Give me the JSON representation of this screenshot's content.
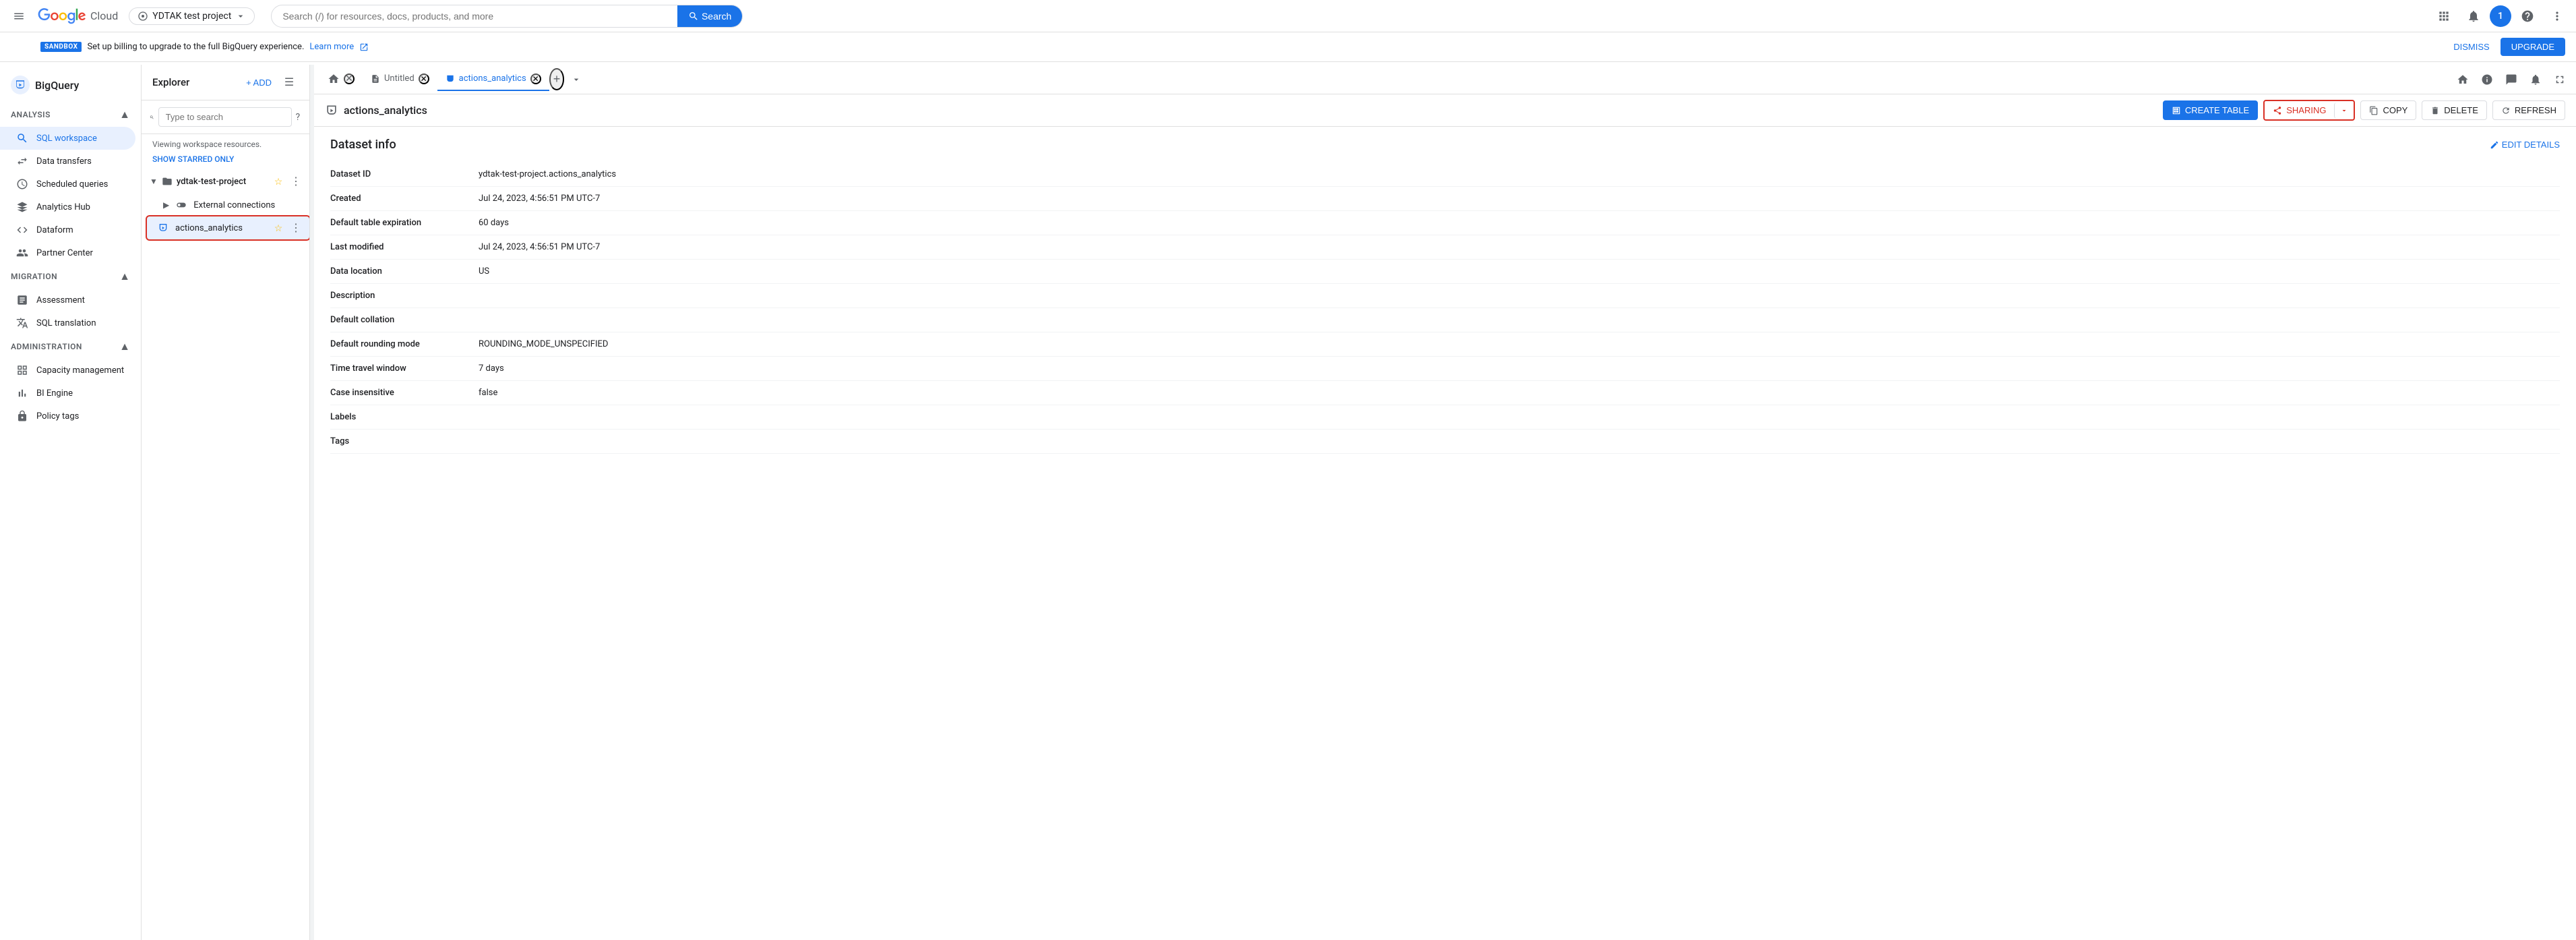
{
  "topbar": {
    "hamburger_label": "Main menu",
    "logo_text": "Google Cloud",
    "project_selector_text": "YDTAK test project",
    "search_placeholder": "Search (/) for resources, docs, products, and more",
    "search_btn_label": "Search",
    "apps_icon": "apps",
    "notifications_icon": "notifications",
    "user_initial": "1",
    "help_icon": "help",
    "more_icon": "more_vert"
  },
  "sandbox_banner": {
    "badge_text": "SANDBOX",
    "message": "Set up billing to upgrade to the full BigQuery experience.",
    "link_text": "Learn more",
    "dismiss_label": "DISMISS",
    "upgrade_label": "UPGRADE"
  },
  "sidebar": {
    "app_name": "BigQuery",
    "sections": [
      {
        "id": "analysis",
        "label": "Analysis",
        "items": [
          {
            "id": "sql-workspace",
            "label": "SQL workspace",
            "icon": "search",
            "active": true
          },
          {
            "id": "data-transfers",
            "label": "Data transfers",
            "icon": "swap_horiz"
          },
          {
            "id": "scheduled-queries",
            "label": "Scheduled queries",
            "icon": "schedule"
          },
          {
            "id": "analytics-hub",
            "label": "Analytics Hub",
            "icon": "hub"
          },
          {
            "id": "dataform",
            "label": "Dataform",
            "icon": "data_object"
          },
          {
            "id": "partner-center",
            "label": "Partner Center",
            "icon": "handshake"
          }
        ]
      },
      {
        "id": "migration",
        "label": "Migration",
        "items": [
          {
            "id": "assessment",
            "label": "Assessment",
            "icon": "assessment"
          },
          {
            "id": "sql-translation",
            "label": "SQL translation",
            "icon": "translate"
          }
        ]
      },
      {
        "id": "administration",
        "label": "Administration",
        "items": [
          {
            "id": "capacity-management",
            "label": "Capacity management",
            "icon": "grid_view"
          },
          {
            "id": "bi-engine",
            "label": "BI Engine",
            "icon": "bar_chart"
          },
          {
            "id": "policy-tags",
            "label": "Policy tags",
            "icon": "lock"
          }
        ]
      }
    ]
  },
  "explorer": {
    "title": "Explorer",
    "add_label": "+ ADD",
    "search_placeholder": "Type to search",
    "workspace_info": "Viewing workspace resources.",
    "starred_only_label": "SHOW STARRED ONLY",
    "project": {
      "name": "ydtak-test-project",
      "items": [
        {
          "id": "external-connections",
          "label": "External connections",
          "icon": "connection",
          "expanded": true
        },
        {
          "id": "actions-analytics",
          "label": "actions_analytics",
          "icon": "dataset",
          "active": true,
          "selected": true
        }
      ]
    }
  },
  "tabs": [
    {
      "id": "home",
      "type": "home",
      "icon": "home",
      "closeable": false
    },
    {
      "id": "untitled",
      "label": "Untitled",
      "closeable": true
    },
    {
      "id": "actions-analytics-tab",
      "label": "actions_analytics",
      "closeable": true,
      "active": true
    }
  ],
  "toolbar": {
    "dataset_icon": "table",
    "dataset_title": "actions_analytics",
    "create_table_label": "CREATE TABLE",
    "sharing_label": "SHARING",
    "copy_label": "COPY",
    "delete_label": "DELETE",
    "refresh_label": "REFRESH",
    "edit_details_label": "EDIT DETAILS"
  },
  "dataset_info": {
    "title": "Dataset info",
    "fields": [
      {
        "label": "Dataset ID",
        "value": "ydtak-test-project.actions_analytics"
      },
      {
        "label": "Created",
        "value": "Jul 24, 2023, 4:56:51 PM UTC-7"
      },
      {
        "label": "Default table expiration",
        "value": "60 days"
      },
      {
        "label": "Last modified",
        "value": "Jul 24, 2023, 4:56:51 PM UTC-7"
      },
      {
        "label": "Data location",
        "value": "US"
      },
      {
        "label": "Description",
        "value": ""
      },
      {
        "label": "Default collation",
        "value": ""
      },
      {
        "label": "Default rounding mode",
        "value": "ROUNDING_MODE_UNSPECIFIED"
      },
      {
        "label": "Time travel window",
        "value": "7 days"
      },
      {
        "label": "Case insensitive",
        "value": "false"
      },
      {
        "label": "Labels",
        "value": ""
      },
      {
        "label": "Tags",
        "value": ""
      }
    ]
  }
}
